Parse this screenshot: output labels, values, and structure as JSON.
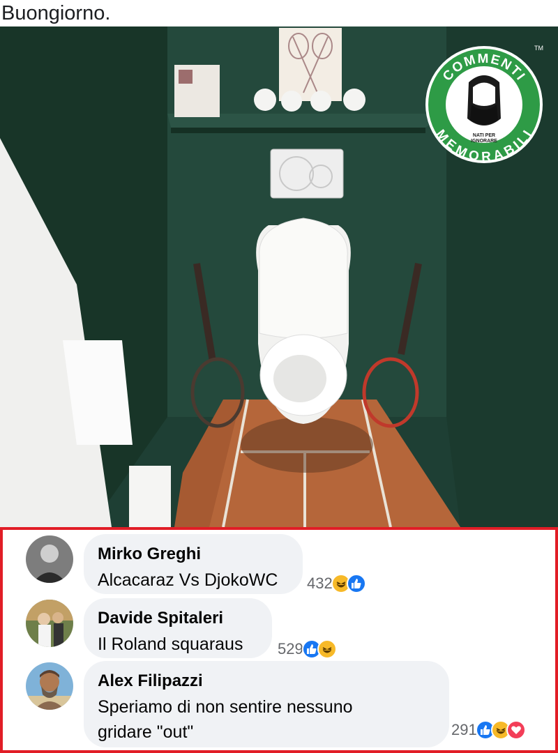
{
  "post": {
    "caption": "Buongiorno."
  },
  "logo": {
    "top_text": "COMMENTI",
    "bottom_text": "MEMORABILI",
    "tagline_line1": "NATI PER",
    "tagline_line2": "IGNORARE",
    "tm": "TM"
  },
  "comments": [
    {
      "author": "Mirko Greghi",
      "text": "Alcacaraz Vs DjokoWC",
      "count": "432",
      "reactions": [
        "haha-icon",
        "like-icon"
      ]
    },
    {
      "author": "Davide Spitaleri",
      "text": "Il Roland squaraus",
      "count": "529",
      "reactions": [
        "like-icon",
        "haha-icon"
      ]
    },
    {
      "author": "Alex Filipazzi",
      "text_line1": "Speriamo di non sentire nessuno",
      "text_line2": "gridare \"out\"",
      "count": "291",
      "reactions": [
        "like-icon",
        "haha-icon",
        "love-icon"
      ]
    }
  ],
  "colors": {
    "highlight_border": "#e11d26",
    "wall": "#1f4136",
    "clay": "#b5663a",
    "logo_green": "#2e9b46"
  }
}
